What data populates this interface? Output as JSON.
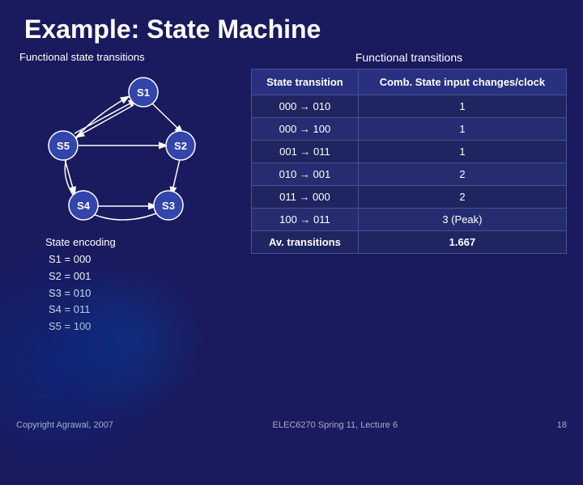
{
  "title": "Example: State Machine",
  "left": {
    "functional_state_label": "Functional state transitions",
    "diagram": {
      "nodes": [
        "S1",
        "S2",
        "S3",
        "S4",
        "S5"
      ]
    },
    "encoding_title": "State encoding",
    "encoding_lines": [
      "S1 = 000",
      "S2 = 001",
      "S3 = 010",
      "S4 = 011",
      "S5 = 100"
    ]
  },
  "right": {
    "label": "Functional transitions",
    "col1_header": "State transition",
    "col2_header": "Comb. State input changes/clock",
    "rows": [
      {
        "transition": "000 → 010",
        "value": "1"
      },
      {
        "transition": "000 → 100",
        "value": "1"
      },
      {
        "transition": "001 → 011",
        "value": "1"
      },
      {
        "transition": "010 → 001",
        "value": "2"
      },
      {
        "transition": "011 → 000",
        "value": "2"
      },
      {
        "transition": "100 → 011",
        "value": "3 (Peak)"
      }
    ],
    "av_label": "Av. transitions",
    "av_value": "1.667"
  },
  "footer": {
    "left": "Copyright Agrawal, 2007",
    "center": "ELEC6270 Spring 11, Lecture 6",
    "right": "18"
  }
}
